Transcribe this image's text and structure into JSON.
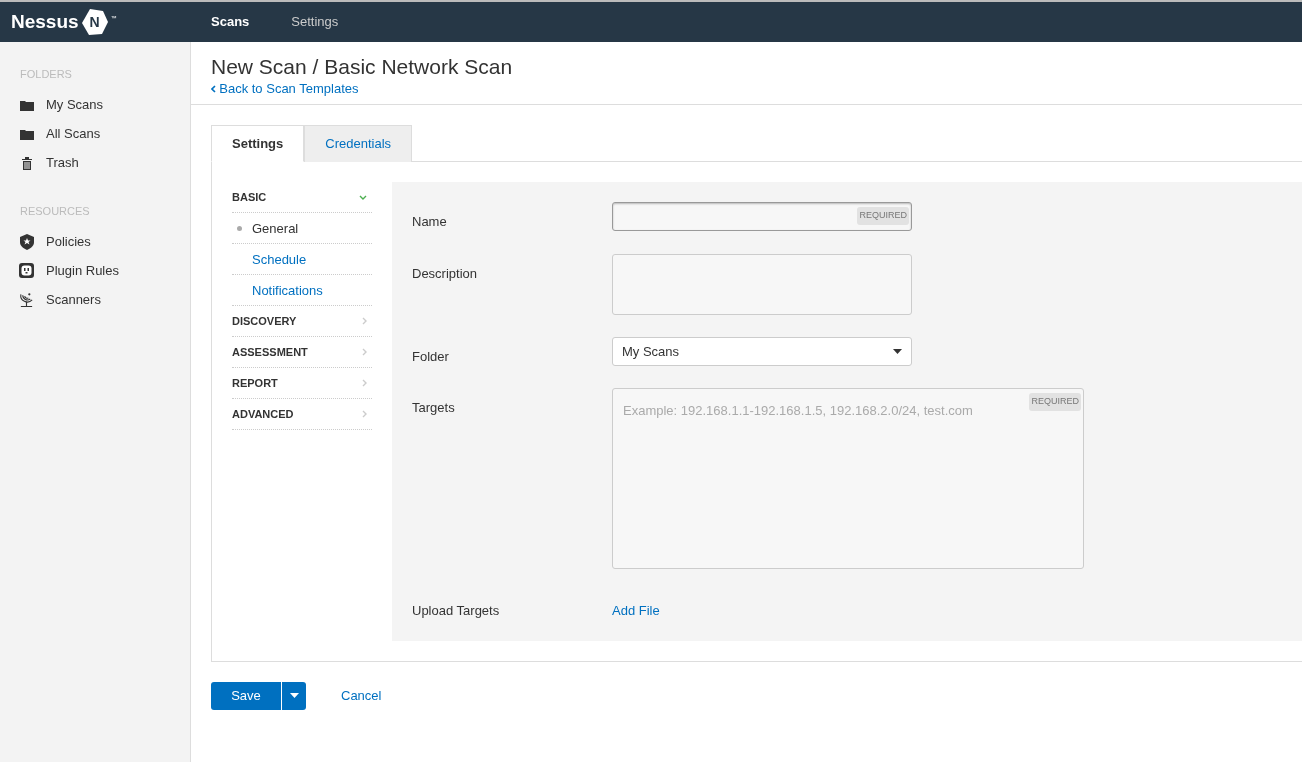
{
  "topbar": {
    "logo_text": "Nessus",
    "logo_mark": "N",
    "trademark": "™",
    "nav": [
      {
        "label": "Scans",
        "selected": true
      },
      {
        "label": "Settings",
        "selected": false
      }
    ]
  },
  "sidebar": {
    "sections": [
      {
        "heading": "FOLDERS",
        "items": [
          {
            "label": "My Scans",
            "kind": "folder"
          },
          {
            "label": "All Scans",
            "kind": "folder"
          },
          {
            "label": "Trash",
            "kind": "trash"
          }
        ]
      },
      {
        "heading": "RESOURCES",
        "items": [
          {
            "label": "Policies",
            "kind": "policy"
          },
          {
            "label": "Plugin Rules",
            "kind": "plugin"
          },
          {
            "label": "Scanners",
            "kind": "scanner"
          }
        ]
      }
    ]
  },
  "page": {
    "title": "New Scan / Basic Network Scan",
    "back_link": "Back to Scan Templates"
  },
  "tabs": [
    {
      "label": "Settings",
      "selected": true
    },
    {
      "label": "Credentials",
      "selected": false
    }
  ],
  "settings_nav": [
    {
      "label": "BASIC",
      "expanded": true,
      "children": [
        {
          "label": "General",
          "selected": true
        },
        {
          "label": "Schedule",
          "selected": false
        },
        {
          "label": "Notifications",
          "selected": false
        }
      ]
    },
    {
      "label": "DISCOVERY",
      "expanded": false
    },
    {
      "label": "ASSESSMENT",
      "expanded": false
    },
    {
      "label": "REPORT",
      "expanded": false
    },
    {
      "label": "ADVANCED",
      "expanded": false
    }
  ],
  "form": [
    {
      "label": "Name",
      "kind": "text",
      "badge": "REQUIRED"
    },
    {
      "label": "Description",
      "kind": "textarea"
    },
    {
      "label": "Folder",
      "kind": "select",
      "value": "My Scans"
    },
    {
      "label": "Targets",
      "kind": "textarea_large",
      "placeholder": "Example: 192.168.1.1-192.168.1.5, 192.168.2.0/24, test.com",
      "badge": "REQUIRED"
    },
    {
      "label": "Upload Targets",
      "kind": "upload",
      "link": "Add File"
    }
  ],
  "actions": {
    "save": "Save",
    "cancel": "Cancel"
  }
}
